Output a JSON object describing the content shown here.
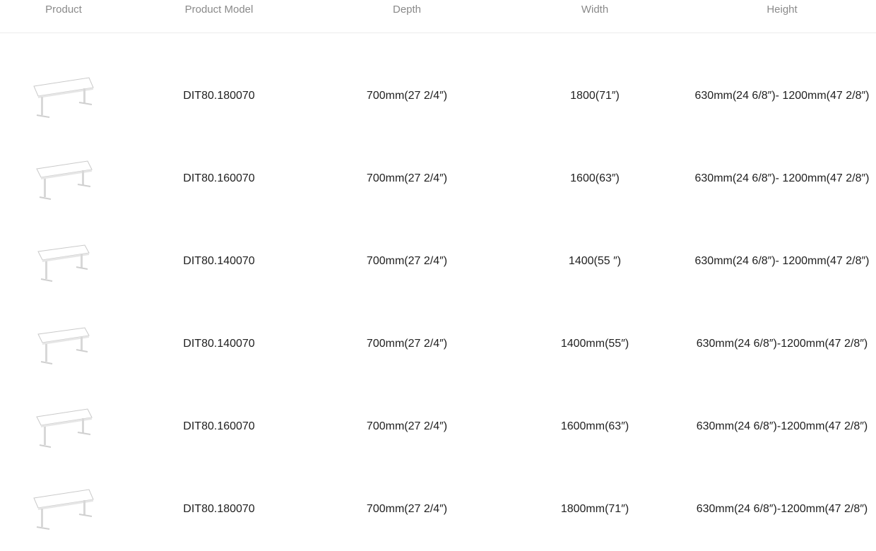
{
  "columns": [
    "Product",
    "Product Model",
    "Depth",
    "Width",
    "Height"
  ],
  "rows": [
    {
      "image": "standing-desk-thumbnail",
      "model": "DIT80.180070",
      "depth": "700mm(27 2/4″)",
      "width": "1800(71″)",
      "height": "630mm(24 6/8″)- 1200mm(47 2/8″)"
    },
    {
      "image": "standing-desk-thumbnail",
      "model": "DIT80.160070",
      "depth": "700mm(27 2/4″)",
      "width": "1600(63″)",
      "height": "630mm(24 6/8″)- 1200mm(47 2/8″)"
    },
    {
      "image": "standing-desk-thumbnail",
      "model": "DIT80.140070",
      "depth": "700mm(27 2/4″)",
      "width": "1400(55 ″)",
      "height": "630mm(24 6/8″)- 1200mm(47 2/8″)"
    },
    {
      "image": "standing-desk-thumbnail",
      "model": "DIT80.140070",
      "depth": "700mm(27 2/4″)",
      "width": "1400mm(55″)",
      "height": "630mm(24 6/8″)-1200mm(47 2/8″)"
    },
    {
      "image": "standing-desk-thumbnail",
      "model": "DIT80.160070",
      "depth": "700mm(27 2/4″)",
      "width": "1600mm(63″)",
      "height": "630mm(24 6/8″)-1200mm(47 2/8″)"
    },
    {
      "image": "standing-desk-thumbnail",
      "model": "DIT80.180070",
      "depth": "700mm(27 2/4″)",
      "width": "1800mm(71″)",
      "height": "630mm(24 6/8″)-1200mm(47 2/8″)"
    }
  ]
}
